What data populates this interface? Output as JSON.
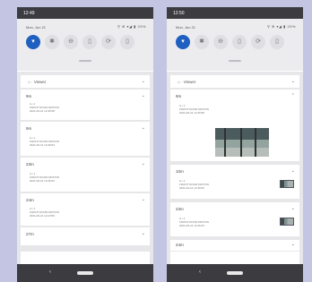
{
  "left": {
    "status_time": "12:49",
    "qs_date": "Mon, Jun 21",
    "qs_status": "⚲ ⊕ ▾◢ ▮ 25%",
    "tiles": [
      {
        "icon": "wifi-icon",
        "glyph": "▾"
      },
      {
        "icon": "bluetooth-icon",
        "glyph": "✱"
      },
      {
        "icon": "do-not-disturb-icon",
        "glyph": "⊖"
      },
      {
        "icon": "flashlight-icon",
        "glyph": "▯"
      },
      {
        "icon": "auto-rotate-icon",
        "glyph": "⟳"
      },
      {
        "icon": "battery-saver-icon",
        "glyph": "▯"
      }
    ],
    "group_label": "⌂ · Viewer",
    "group_chevron": "⌄",
    "cards": [
      {
        "time": "9m",
        "chevron": "⌄",
        "line1": "A ▪ 1",
        "line2": "FRONT DOOR MOTION",
        "line3": "2021-06-21 12:39:58"
      },
      {
        "time": "9m",
        "chevron": "⌄",
        "line1": "A ▪ 1",
        "line2": "FRONT DOOR MOTION",
        "line3": "2021-06-21 12:39:53"
      },
      {
        "time": "23m",
        "chevron": "⌄",
        "line1": "A ▪ 1",
        "line2": "FRONT DOOR MOTION",
        "line3": "2021-06-21 12:26:03"
      },
      {
        "time": "24m",
        "chevron": "⌄",
        "line1": "A ▪ 1",
        "line2": "FRONT DOOR MOTION",
        "line3": "2021-06-21 12:24:56"
      },
      {
        "time": "27m",
        "chevron": "⌄"
      }
    ],
    "footer_icons": [
      "⊛",
      "▶",
      "•"
    ]
  },
  "right": {
    "status_time": "12:50",
    "qs_date": "Mon, Jun 21",
    "qs_status": "⚲ ⊕ ▾◢ ▮ 25%",
    "tiles": [
      {
        "icon": "wifi-icon",
        "glyph": "▾"
      },
      {
        "icon": "bluetooth-icon",
        "glyph": "✱"
      },
      {
        "icon": "do-not-disturb-icon",
        "glyph": "⊖"
      },
      {
        "icon": "flashlight-icon",
        "glyph": "▯"
      },
      {
        "icon": "auto-rotate-icon",
        "glyph": "⟳"
      },
      {
        "icon": "battery-saver-icon",
        "glyph": "▯"
      }
    ],
    "group_label": "⌂ · Viewer",
    "group_chevron": "⌄",
    "cards": [
      {
        "time": "9m",
        "chevron": "⌃",
        "line1": "A ▪ 1",
        "line2": "FRONT DOOR MOTION",
        "line3": "2021-06-21 12:39:58"
      },
      {
        "time": "10m",
        "chevron": "⌄",
        "line1": "A ▪ 1",
        "line2": "FRONT DOOR MOTION",
        "line3": "2021-06-21 12:39:53"
      },
      {
        "time": "23m",
        "chevron": "⌄",
        "line1": "A ▪ 1",
        "line2": "FRONT DOOR MOTION",
        "line3": "2021-06-21 12:26:03"
      },
      {
        "time": "24m",
        "chevron": "⌄"
      }
    ],
    "footer_icons": [
      "⊛",
      "▶",
      "•"
    ]
  },
  "nav": {
    "back_glyph": "‹"
  }
}
